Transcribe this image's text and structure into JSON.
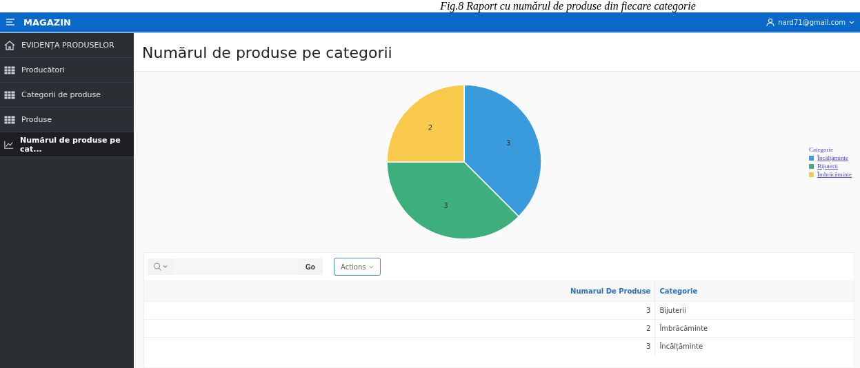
{
  "caption": "Fig.8 Raport cu numărul de produse din fiecare categorie",
  "header": {
    "app_name": "MAGAZIN",
    "user": "nard71@gmail.com"
  },
  "sidebar": {
    "items": [
      {
        "label": "EVIDENȚA PRODUSELOR",
        "kind": "home",
        "selected": false
      },
      {
        "label": "Producători",
        "kind": "table",
        "selected": false
      },
      {
        "label": "Categorii de produse",
        "kind": "table",
        "selected": false
      },
      {
        "label": "Produse",
        "kind": "table",
        "selected": false
      },
      {
        "label": "Numărul de produse pe cat...",
        "kind": "chart",
        "selected": true
      }
    ]
  },
  "page_title": "Numărul de produse pe categorii",
  "chart": {
    "chart_data": {
      "type": "pie",
      "categories": [
        "Încălțăminte",
        "Bijuterii",
        "Îmbrăcăminte"
      ],
      "series": [
        {
          "name": "Categorie",
          "values": [
            3,
            3,
            2
          ]
        }
      ],
      "data_labels": true
    },
    "legend": [
      {
        "color": "#3a9bdc"
      },
      {
        "color": "#3daf7c"
      },
      {
        "color": "#f8c94b"
      }
    ]
  },
  "toolbar": {
    "go": "Go",
    "actions": "Actions"
  },
  "table": {
    "columns": [
      "Numarul De Produse",
      "Categorie"
    ],
    "rows": [
      [
        "3",
        "Bijuterii"
      ],
      [
        "2",
        "Îmbrăcăminte"
      ],
      [
        "3",
        "Încălțăminte"
      ]
    ]
  }
}
